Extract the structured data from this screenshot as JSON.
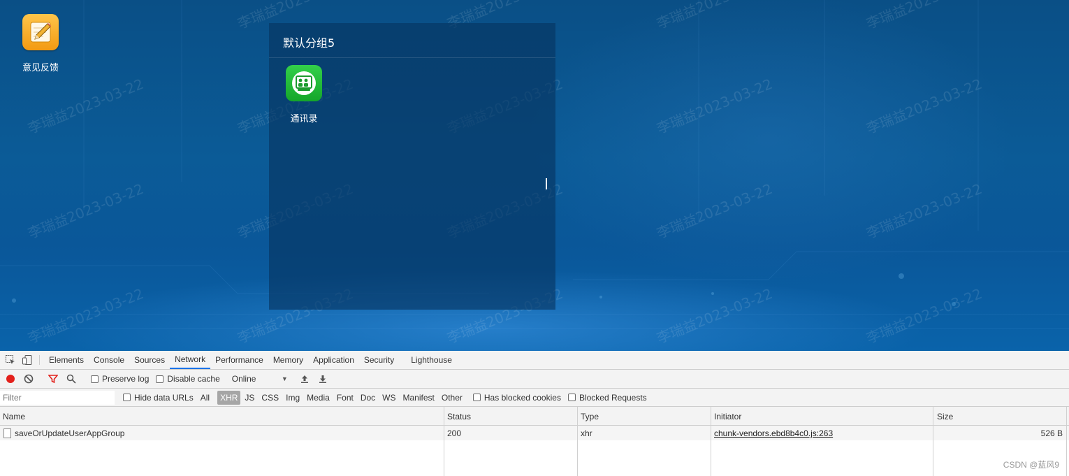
{
  "desktop": {
    "icon": {
      "label": "意见反馈",
      "icon": "pencil-notepad-icon"
    },
    "group": {
      "title": "默认分组5",
      "apps": [
        {
          "label": "通讯录",
          "icon": "contacts-board-icon"
        }
      ]
    },
    "watermark": "李瑞益2023-03-22"
  },
  "devtools": {
    "tabs": [
      "Elements",
      "Console",
      "Sources",
      "Network",
      "Performance",
      "Memory",
      "Application",
      "Security",
      "Lighthouse"
    ],
    "active_tab": "Network",
    "toolbar": {
      "preserve_log": "Preserve log",
      "disable_cache": "Disable cache",
      "throttle": "Online"
    },
    "filterbar": {
      "filter_placeholder": "Filter",
      "hide_data_urls": "Hide data URLs",
      "types": [
        "All",
        "XHR",
        "JS",
        "CSS",
        "Img",
        "Media",
        "Font",
        "Doc",
        "WS",
        "Manifest",
        "Other"
      ],
      "active_type": "XHR",
      "has_blocked_cookies": "Has blocked cookies",
      "blocked_requests": "Blocked Requests"
    },
    "table": {
      "columns": [
        "Name",
        "Status",
        "Type",
        "Initiator",
        "Size"
      ],
      "rows": [
        {
          "name": "saveOrUpdateUserAppGroup",
          "status": "200",
          "type": "xhr",
          "initiator": "chunk-vendors.ebd8b4c0.js:263",
          "size": "526 B"
        }
      ]
    }
  },
  "footer": {
    "credit": "CSDN @蓝风9"
  },
  "colors": {
    "accent": "#1a73e8",
    "record": "#e3201b",
    "desktop_bg": "#0b5b97"
  }
}
